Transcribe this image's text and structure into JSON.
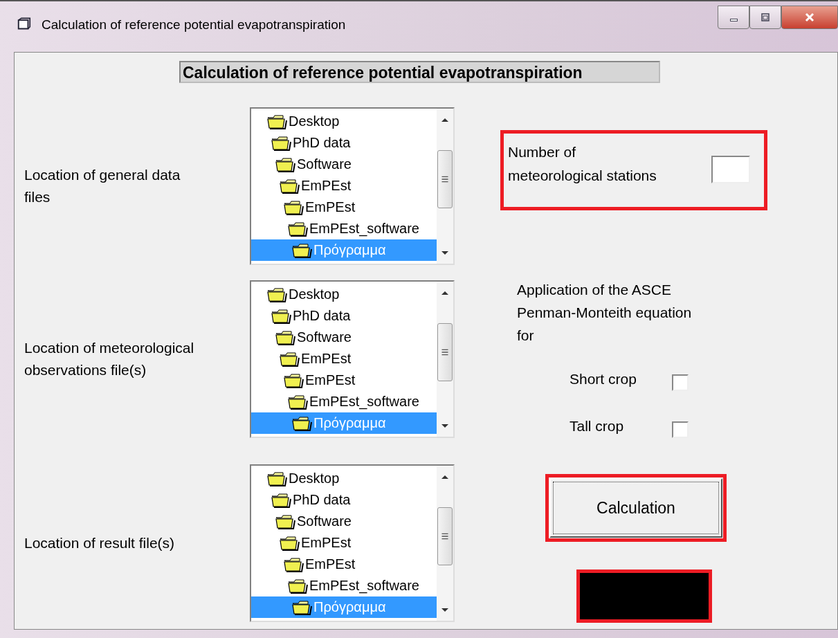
{
  "window": {
    "title": "Calculation of reference potential evapotranspiration"
  },
  "heading": "Calculation of reference potential evapotranspiration",
  "rows": [
    {
      "label": "Location of general data files",
      "tree": [
        {
          "name": "Desktop",
          "selected": false,
          "children": [
            {
              "name": "PhD data",
              "selected": false,
              "children": [
                {
                  "name": "Software",
                  "selected": false,
                  "children": [
                    {
                      "name": "EmPEst",
                      "selected": false,
                      "children": [
                        {
                          "name": "EmPEst",
                          "selected": false,
                          "children": [
                            {
                              "name": "EmPEst_software",
                              "selected": false,
                              "children": [
                                {
                                  "name": "Πρόγραμμα",
                                  "selected": true
                                }
                              ]
                            }
                          ]
                        }
                      ]
                    }
                  ]
                }
              ]
            }
          ]
        }
      ]
    },
    {
      "label": "Location of meteorological observations file(s)",
      "tree": [
        {
          "name": "Desktop",
          "selected": false,
          "children": [
            {
              "name": "PhD data",
              "selected": false,
              "children": [
                {
                  "name": "Software",
                  "selected": false,
                  "children": [
                    {
                      "name": "EmPEst",
                      "selected": false,
                      "children": [
                        {
                          "name": "EmPEst",
                          "selected": false,
                          "children": [
                            {
                              "name": "EmPEst_software",
                              "selected": false,
                              "children": [
                                {
                                  "name": "Πρόγραμμα",
                                  "selected": true
                                }
                              ]
                            }
                          ]
                        }
                      ]
                    }
                  ]
                }
              ]
            }
          ]
        }
      ]
    },
    {
      "label": "Location of result file(s)",
      "tree": [
        {
          "name": "Desktop",
          "selected": false,
          "children": [
            {
              "name": "PhD data",
              "selected": false,
              "children": [
                {
                  "name": "Software",
                  "selected": false,
                  "children": [
                    {
                      "name": "EmPEst",
                      "selected": false,
                      "children": [
                        {
                          "name": "EmPEst",
                          "selected": false,
                          "children": [
                            {
                              "name": "EmPEst_software",
                              "selected": false,
                              "children": [
                                {
                                  "name": "Πρόγραμμα",
                                  "selected": true
                                }
                              ]
                            }
                          ]
                        }
                      ]
                    }
                  ]
                }
              ]
            }
          ]
        }
      ]
    }
  ],
  "stations": {
    "label": "Number of meteorological stations"
  },
  "equation": {
    "label": "Application of the ASCE Penman-Monteith equation for",
    "options": [
      {
        "label": "Short crop",
        "checked": false
      },
      {
        "label": "Tall crop",
        "checked": false
      }
    ]
  },
  "calculate_button": "Calculation"
}
